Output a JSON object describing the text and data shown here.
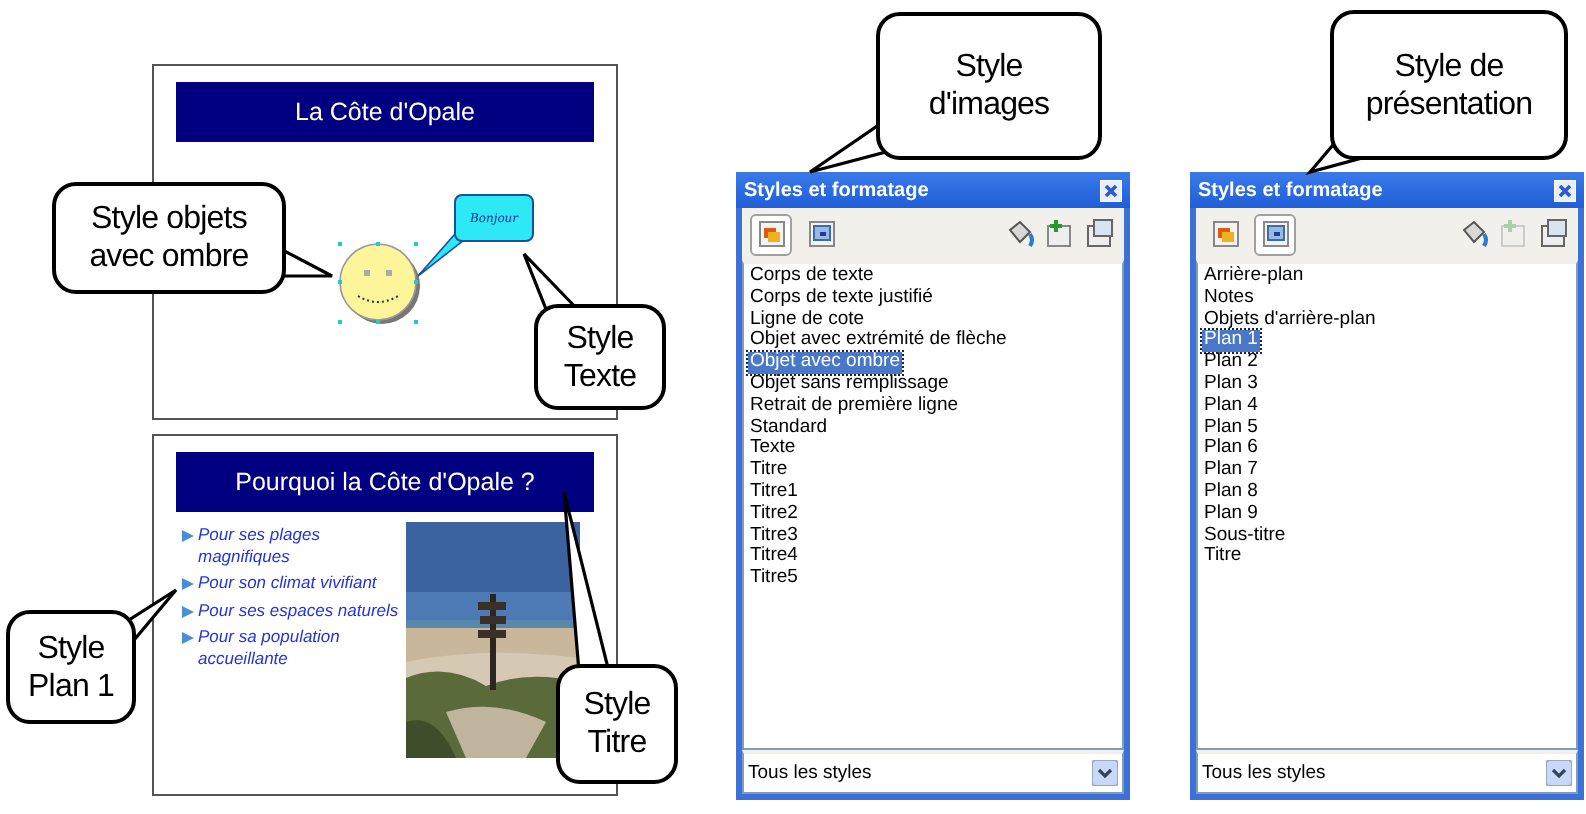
{
  "slides": [
    {
      "kind": "shapes",
      "title": "La Côte d'Opale",
      "bubble_text": "Bonjour"
    },
    {
      "kind": "bullets",
      "title": "Pourquoi la Côte d'Opale ?",
      "bullets": [
        "Pour ses plages magnifiques",
        "Pour son climat vivifiant",
        "Pour ses espaces naturels",
        "Pour sa population accueillante"
      ]
    }
  ],
  "panels": [
    {
      "title": "Styles et formatage",
      "categories": [
        {
          "selected": true
        },
        {
          "selected": false
        }
      ],
      "actions": [
        {
          "disabled": false
        },
        {
          "disabled": false
        },
        {
          "disabled": false
        }
      ],
      "items": [
        {
          "label": "Corps de texte",
          "selected": false
        },
        {
          "label": "Corps de texte justifié",
          "selected": false
        },
        {
          "label": "Ligne de cote",
          "selected": false
        },
        {
          "label": "Objet avec extrémité de flèche",
          "selected": false
        },
        {
          "label": "Objet avec ombre",
          "selected": true
        },
        {
          "label": "Objet sans remplissage",
          "selected": false
        },
        {
          "label": "Retrait de première ligne",
          "selected": false
        },
        {
          "label": "Standard",
          "selected": false
        },
        {
          "label": "Texte",
          "selected": false
        },
        {
          "label": "Titre",
          "selected": false
        },
        {
          "label": "Titre1",
          "selected": false
        },
        {
          "label": "Titre2",
          "selected": false
        },
        {
          "label": "Titre3",
          "selected": false
        },
        {
          "label": "Titre4",
          "selected": false
        },
        {
          "label": "Titre5",
          "selected": false
        }
      ],
      "filter": "Tous les styles"
    },
    {
      "title": "Styles et formatage",
      "categories": [
        {
          "selected": false
        },
        {
          "selected": true
        }
      ],
      "actions": [
        {
          "disabled": false
        },
        {
          "disabled": true
        },
        {
          "disabled": false
        }
      ],
      "items": [
        {
          "label": "Arrière-plan",
          "selected": false
        },
        {
          "label": "Notes",
          "selected": false
        },
        {
          "label": "Objets d'arrière-plan",
          "selected": false
        },
        {
          "label": "Plan 1",
          "selected": true
        },
        {
          "label": "Plan 2",
          "selected": false
        },
        {
          "label": "Plan 3",
          "selected": false
        },
        {
          "label": "Plan 4",
          "selected": false
        },
        {
          "label": "Plan 5",
          "selected": false
        },
        {
          "label": "Plan 6",
          "selected": false
        },
        {
          "label": "Plan 7",
          "selected": false
        },
        {
          "label": "Plan 8",
          "selected": false
        },
        {
          "label": "Plan 9",
          "selected": false
        },
        {
          "label": "Sous-titre",
          "selected": false
        },
        {
          "label": "Titre",
          "selected": false
        }
      ],
      "filter": "Tous les styles"
    }
  ],
  "callouts": [
    {
      "text": "Style objets avec ombre"
    },
    {
      "text": "Style Texte"
    },
    {
      "text": "Style Plan 1"
    },
    {
      "text": "Style Titre"
    },
    {
      "text": "Style d'images"
    },
    {
      "text": "Style de présentation"
    }
  ]
}
